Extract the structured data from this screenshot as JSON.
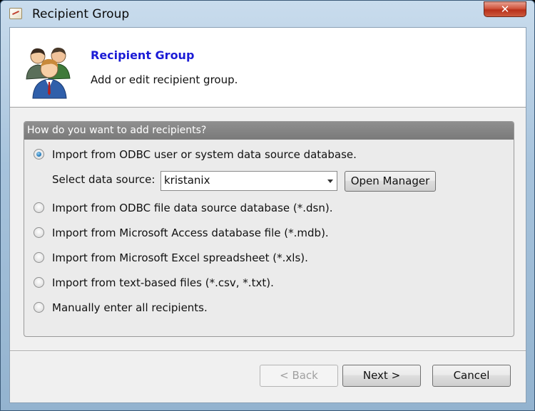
{
  "window": {
    "title": "Recipient Group",
    "close_glyph": "✕"
  },
  "header": {
    "title": "Recipient Group",
    "subtitle": "Add or edit recipient group.",
    "icon": "users-group-icon"
  },
  "group": {
    "heading": "How do you want to add recipients?",
    "options": [
      {
        "label": "Import from ODBC user or system data source database.",
        "selected": true
      },
      {
        "label": "Import from ODBC file data source database (*.dsn).",
        "selected": false
      },
      {
        "label": "Import from Microsoft Access database file (*.mdb).",
        "selected": false
      },
      {
        "label": "Import from Microsoft Excel spreadsheet (*.xls).",
        "selected": false
      },
      {
        "label": "Import from text-based files (*.csv, *.txt).",
        "selected": false
      },
      {
        "label": "Manually enter all recipients.",
        "selected": false
      }
    ],
    "data_source": {
      "label": "Select data source:",
      "value": "kristanix",
      "manager_button": "Open Manager"
    }
  },
  "footer": {
    "back": "< Back",
    "next": "Next >",
    "cancel": "Cancel",
    "back_enabled": false
  }
}
